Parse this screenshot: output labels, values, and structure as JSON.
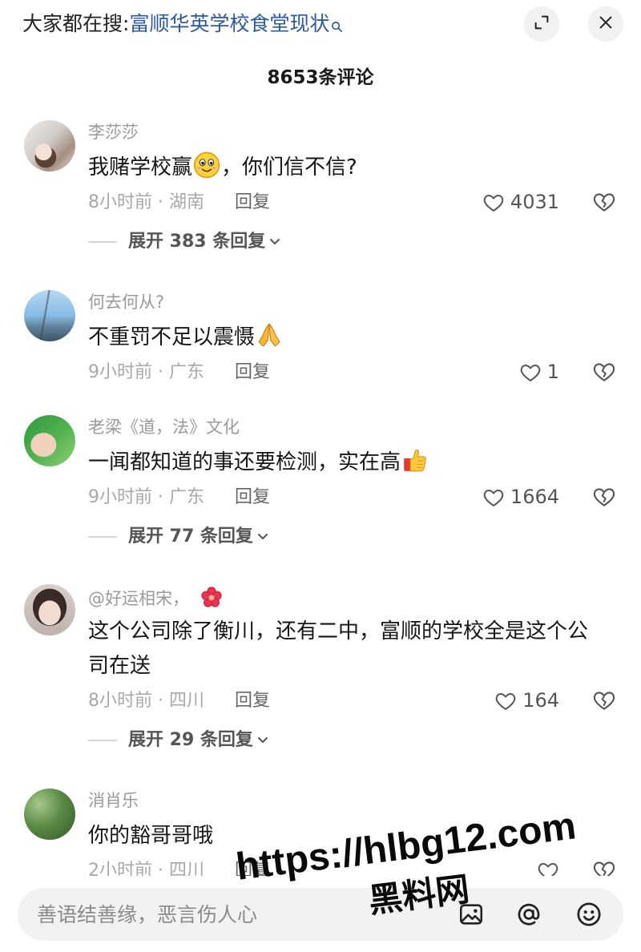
{
  "header": {
    "search_prefix": "大家都在搜:",
    "search_query": "富顺华英学校食堂现状"
  },
  "comment_count": "8653条评论",
  "comments": [
    {
      "author": "李莎莎",
      "text_before": "我赌学校赢",
      "emoji": "smiling-face-emoji",
      "text_after": "，你们信不信?",
      "time_location": "8小时前 · 湖南",
      "reply": "回复",
      "likes": "4031",
      "expand": "展开 383 条回复"
    },
    {
      "author": "何去何从?",
      "text_before": "不重罚不足以震慑",
      "emoji": "folded-hands-emoji",
      "time_location": "9小时前 · 广东",
      "reply": "回复",
      "likes": "1"
    },
    {
      "author": "老梁《道，法》文化",
      "text_before": "一闻都知道的事还要检测，实在高",
      "emoji": "thumbs-up-emoji",
      "time_location": "9小时前 · 广东",
      "reply": "回复",
      "likes": "1664",
      "expand": "展开 77 条回复"
    },
    {
      "author": "@好运相宋，",
      "author_emoji": "hibiscus-emoji",
      "text": "这个公司除了衡川，还有二中，富顺的学校全是这个公司在送",
      "time_location": "8小时前 · 四川",
      "reply": "回复",
      "likes": "164",
      "expand": "展开 29 条回复"
    },
    {
      "author": "消肖乐",
      "text": "你的豁哥哥哦",
      "time_location": "2小时前 · 四川",
      "reply": "回复"
    }
  ],
  "input": {
    "placeholder": "善语结善缘，恶言伤人心"
  },
  "watermark": {
    "url": "https://hlbg12.com",
    "site": "黑料网"
  },
  "icons": {
    "search": "search-icon",
    "expand": "expand-icon",
    "close": "close-icon",
    "like": "heart-icon",
    "dislike": "broken-heart-icon",
    "expand_chevron": "chevron-down-icon",
    "image": "image-icon",
    "mention": "at-icon",
    "emoji_picker": "smiley-icon"
  },
  "colors": {
    "search_query": "#2c5aa0",
    "primary_text": "#161616",
    "secondary_text": "#9a9a9a",
    "button_bg": "#f1f1f1",
    "watermark": "#0a0a0a"
  }
}
